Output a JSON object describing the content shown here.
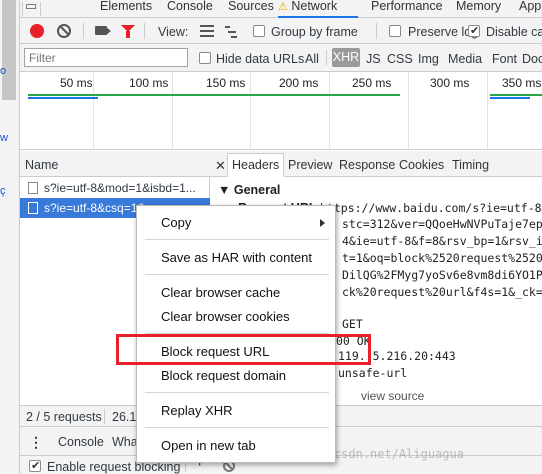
{
  "tabs": {
    "elements": "Elements",
    "console": "Console",
    "sources": "Sources",
    "network": "Network",
    "performance": "Performance",
    "memory": "Memory",
    "application": "App"
  },
  "toolbar": {
    "view_label": "View:",
    "group_by_frame": "Group by frame",
    "preserve_log": "Preserve log",
    "disable_cache": "Disable ca",
    "disable_cache_checked": true
  },
  "filter": {
    "placeholder": "Filter",
    "hide_data_urls": "Hide data URLs",
    "types": [
      "All",
      "XHR",
      "JS",
      "CSS",
      "Img",
      "Media",
      "Font",
      "Doc"
    ],
    "active_type": "XHR"
  },
  "timeline": {
    "ticks": [
      "50 ms",
      "100 ms",
      "150 ms",
      "200 ms",
      "250 ms",
      "300 ms",
      "350 ms"
    ]
  },
  "requests": {
    "header": "Name",
    "rows": [
      "s?ie=utf-8&mod=1&isbd=1...",
      "s?ie=utf-8&csq=1&..."
    ]
  },
  "details": {
    "tabs": [
      "Headers",
      "Preview",
      "Response",
      "Cookies",
      "Timing"
    ],
    "active_tab": "Headers",
    "close_glyph": "✕",
    "general_heading": "▼ General",
    "request_url_label": "Request URL:",
    "request_url_value": "https://www.baidu.com/s?ie=utf-8&c",
    "lines": [
      "stc=312&ver=QQoeHwNVPuTaje7ep4TX",
      "4&ie=utf-8&f=8&rsv_bp=1&rsv_idx=",
      "t=1&oq=block%2520request%2520url",
      "DilQG%2FMyg7yoSv6e8vm8di6YO1Pswv",
      "ck%20request%20url&f4s=1&_ck=250"
    ],
    "method": "GET",
    "status_fragment": "00 OK",
    "remote_address": "119.  5.216.20:443",
    "referrer_policy": "unsafe-url",
    "view_source": "view source"
  },
  "status": {
    "requests": "2 / 5 requests",
    "transferred": "26.1"
  },
  "drawer": {
    "console_tab": "Console",
    "whats_new": "Wha"
  },
  "bottom": {
    "enable_request_blocking": "Enable request blocking",
    "add": "+"
  },
  "context_menu": {
    "copy": "Copy",
    "save_har": "Save as HAR with content",
    "clear_cache": "Clear browser cache",
    "clear_cookies": "Clear browser cookies",
    "block_url": "Block request URL",
    "block_domain": "Block request domain",
    "replay_xhr": "Replay XHR",
    "open_new_tab": "Open in new tab"
  },
  "watermark": "https://blog.csdn.net/Aliguagua",
  "colors": {
    "accent": "#1a73e8",
    "selected_row": "#3879d9",
    "record": "#e8202a",
    "highlight_box": "#e8202a",
    "warning": "#e6a700"
  }
}
